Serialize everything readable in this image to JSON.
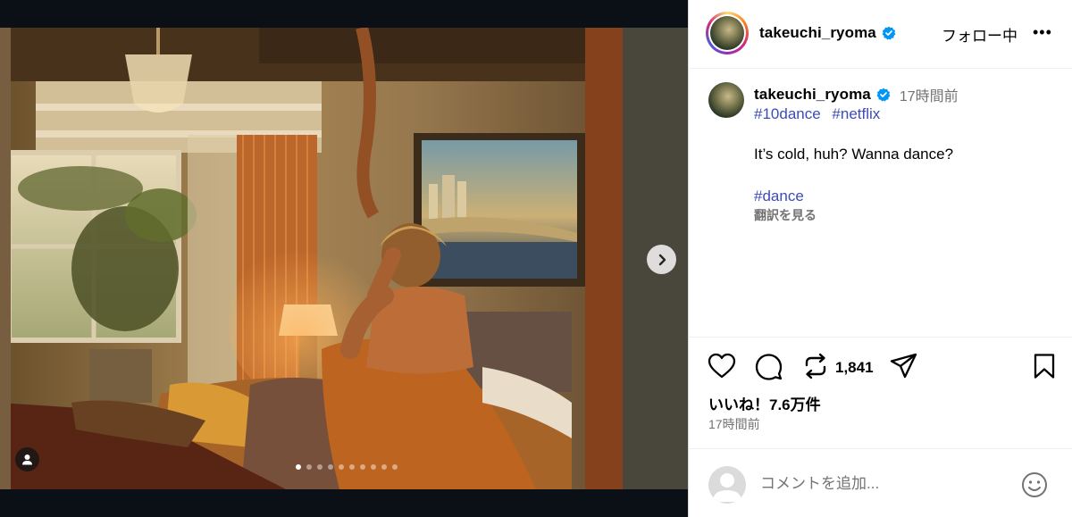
{
  "post": {
    "username": "takeuchi_ryoma",
    "follow_label": "フォロー中",
    "more_label": "•••",
    "caption": {
      "time": "17時間前",
      "tags_line1": [
        "#10dance",
        "#netflix"
      ],
      "text": "It’s cold, huh? Wanna dance?",
      "tags_line2": [
        "#dance"
      ],
      "translate_label": "翻訳を見る"
    },
    "repost_count": "1,841",
    "likes_label": "いいね！7.6万件",
    "post_time": "17時間前",
    "comment_placeholder": "コメントを追加..."
  },
  "carousel": {
    "total_slides": 10,
    "active_index": 0
  },
  "colors": {
    "accent_link": "#3c4bb9",
    "verified_blue": "#0095f6",
    "media_bg": "#0b0f16"
  },
  "icons": [
    "chevron-right-icon",
    "person-tag-icon",
    "verified-badge-icon",
    "heart-icon",
    "comment-icon",
    "repost-icon",
    "share-icon",
    "bookmark-icon",
    "emoji-icon"
  ]
}
